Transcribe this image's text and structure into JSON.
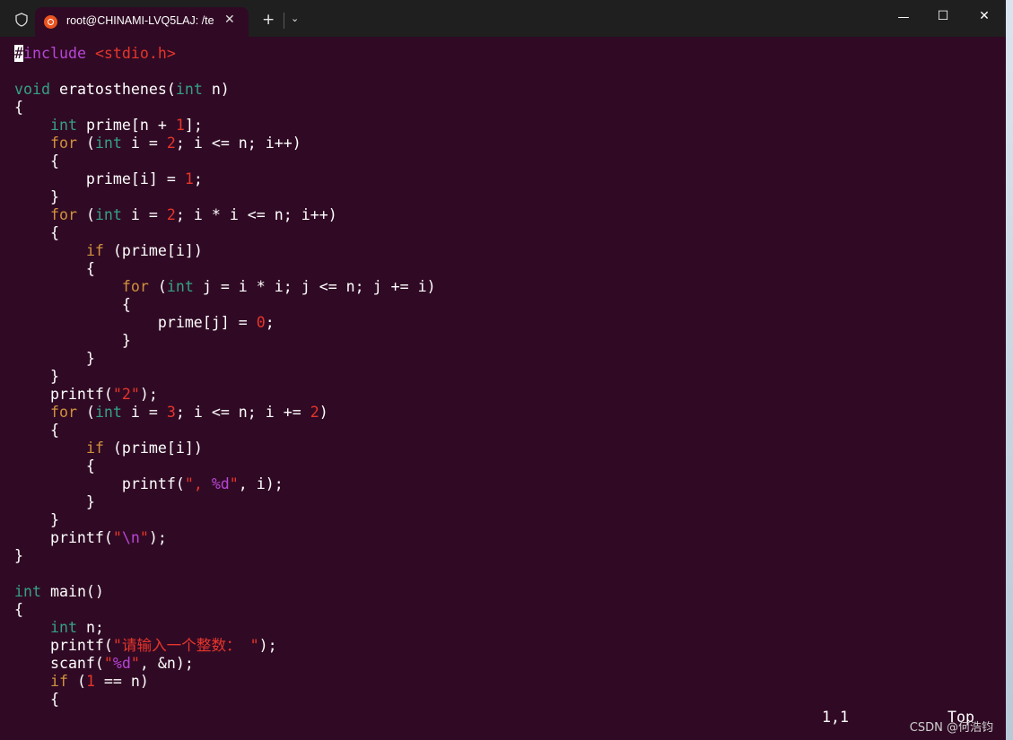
{
  "window": {
    "tab_title": "root@CHINAMI-LVQ5LAJ: /te",
    "tab_close": "✕",
    "new_tab": "+",
    "dropdown": "⌄",
    "minimize": "—",
    "maximize": "☐",
    "close": "✕"
  },
  "code_lines": [
    [
      {
        "t": "#",
        "c": "cursor"
      },
      {
        "t": "include ",
        "c": "pp"
      },
      {
        "t": "<stdio.h>",
        "c": "str"
      }
    ],
    [],
    [
      {
        "t": "void",
        "c": "ty"
      },
      {
        "t": " eratosthenes("
      },
      {
        "t": "int",
        "c": "ty"
      },
      {
        "t": " n)"
      }
    ],
    [
      {
        "t": "{"
      }
    ],
    [
      {
        "t": "    "
      },
      {
        "t": "int",
        "c": "ty"
      },
      {
        "t": " prime[n + "
      },
      {
        "t": "1",
        "c": "num"
      },
      {
        "t": "];"
      }
    ],
    [
      {
        "t": "    "
      },
      {
        "t": "for",
        "c": "kw"
      },
      {
        "t": " ("
      },
      {
        "t": "int",
        "c": "ty"
      },
      {
        "t": " i = "
      },
      {
        "t": "2",
        "c": "num"
      },
      {
        "t": "; i <= n; i++)"
      }
    ],
    [
      {
        "t": "    {"
      }
    ],
    [
      {
        "t": "        prime[i] = "
      },
      {
        "t": "1",
        "c": "num"
      },
      {
        "t": ";"
      }
    ],
    [
      {
        "t": "    }"
      }
    ],
    [
      {
        "t": "    "
      },
      {
        "t": "for",
        "c": "kw"
      },
      {
        "t": " ("
      },
      {
        "t": "int",
        "c": "ty"
      },
      {
        "t": " i = "
      },
      {
        "t": "2",
        "c": "num"
      },
      {
        "t": "; i * i <= n; i++)"
      }
    ],
    [
      {
        "t": "    {"
      }
    ],
    [
      {
        "t": "        "
      },
      {
        "t": "if",
        "c": "kw"
      },
      {
        "t": " (prime[i])"
      }
    ],
    [
      {
        "t": "        {"
      }
    ],
    [
      {
        "t": "            "
      },
      {
        "t": "for",
        "c": "kw"
      },
      {
        "t": " ("
      },
      {
        "t": "int",
        "c": "ty"
      },
      {
        "t": " j = i * i; j <= n; j += i)"
      }
    ],
    [
      {
        "t": "            {"
      }
    ],
    [
      {
        "t": "                prime[j] = "
      },
      {
        "t": "0",
        "c": "num"
      },
      {
        "t": ";"
      }
    ],
    [
      {
        "t": "            }"
      }
    ],
    [
      {
        "t": "        }"
      }
    ],
    [
      {
        "t": "    }"
      }
    ],
    [
      {
        "t": "    printf("
      },
      {
        "t": "\"2\"",
        "c": "str"
      },
      {
        "t": ");"
      }
    ],
    [
      {
        "t": "    "
      },
      {
        "t": "for",
        "c": "kw"
      },
      {
        "t": " ("
      },
      {
        "t": "int",
        "c": "ty"
      },
      {
        "t": " i = "
      },
      {
        "t": "3",
        "c": "num"
      },
      {
        "t": "; i <= n; i += "
      },
      {
        "t": "2",
        "c": "num"
      },
      {
        "t": ")"
      }
    ],
    [
      {
        "t": "    {"
      }
    ],
    [
      {
        "t": "        "
      },
      {
        "t": "if",
        "c": "kw"
      },
      {
        "t": " (prime[i])"
      }
    ],
    [
      {
        "t": "        {"
      }
    ],
    [
      {
        "t": "            printf("
      },
      {
        "t": "\", ",
        "c": "str"
      },
      {
        "t": "%d",
        "c": "esc"
      },
      {
        "t": "\"",
        "c": "str"
      },
      {
        "t": ", i);"
      }
    ],
    [
      {
        "t": "        }"
      }
    ],
    [
      {
        "t": "    }"
      }
    ],
    [
      {
        "t": "    printf("
      },
      {
        "t": "\"",
        "c": "str"
      },
      {
        "t": "\\n",
        "c": "esc"
      },
      {
        "t": "\"",
        "c": "str"
      },
      {
        "t": ");"
      }
    ],
    [
      {
        "t": "}"
      }
    ],
    [],
    [
      {
        "t": "int",
        "c": "ty"
      },
      {
        "t": " main()"
      }
    ],
    [
      {
        "t": "{"
      }
    ],
    [
      {
        "t": "    "
      },
      {
        "t": "int",
        "c": "ty"
      },
      {
        "t": " n;"
      }
    ],
    [
      {
        "t": "    printf("
      },
      {
        "t": "\"请输入一个整数： \"",
        "c": "str"
      },
      {
        "t": ");"
      }
    ],
    [
      {
        "t": "    scanf("
      },
      {
        "t": "\"",
        "c": "str"
      },
      {
        "t": "%d",
        "c": "esc"
      },
      {
        "t": "\"",
        "c": "str"
      },
      {
        "t": ", &n);"
      }
    ],
    [
      {
        "t": "    "
      },
      {
        "t": "if",
        "c": "kw"
      },
      {
        "t": " ("
      },
      {
        "t": "1",
        "c": "num"
      },
      {
        "t": " == n)"
      }
    ],
    [
      {
        "t": "    {"
      }
    ]
  ],
  "status": {
    "position": "1,1",
    "scroll": "Top"
  },
  "watermark": "CSDN @何浩钧",
  "colors": {
    "background": "#300a24",
    "keyword": "#d0913d",
    "type": "#35a085",
    "number": "#e6352b",
    "preprocessor": "#b845d6"
  }
}
